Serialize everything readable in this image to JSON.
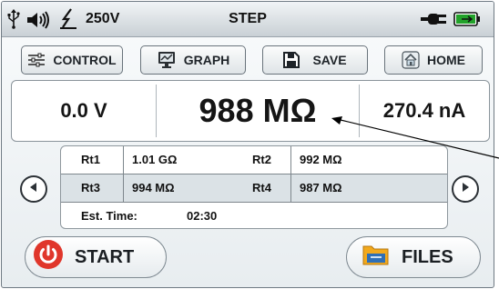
{
  "status_bar": {
    "voltage": "250V",
    "mode": "STEP",
    "icons": [
      "usb-icon",
      "speaker-icon",
      "high-voltage-icon",
      "power-plug-icon",
      "battery-charging-icon"
    ],
    "battery_color": "#22a22a"
  },
  "nav": {
    "control_label": "CONTROL",
    "graph_label": "GRAPH",
    "save_label": "SAVE",
    "home_label": "HOME"
  },
  "readout": {
    "voltage": "0.0 V",
    "resistance": "988 MΩ",
    "current": "270.4 nA"
  },
  "results": {
    "rows": [
      {
        "l1": "Rt1",
        "v1": "1.01 GΩ",
        "l2": "Rt2",
        "v2": "992 MΩ"
      },
      {
        "l1": "Rt3",
        "v1": "994 MΩ",
        "l2": "Rt4",
        "v2": "987 MΩ"
      }
    ],
    "est_time_label": "Est. Time:",
    "est_time_value": "02:30"
  },
  "actions": {
    "start_label": "START",
    "files_label": "FILES",
    "start_color": "#e0362b"
  }
}
